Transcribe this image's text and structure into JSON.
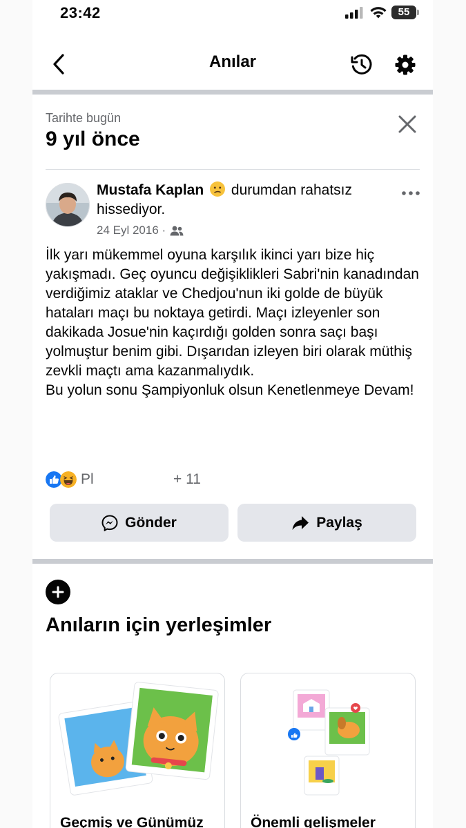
{
  "status_bar": {
    "time": "23:42",
    "battery": "55"
  },
  "header": {
    "title": "Anılar"
  },
  "memory": {
    "subtitle": "Tarihte bugün",
    "title": "9 yıl önce"
  },
  "post": {
    "author": "Mustafa Kaplan",
    "feeling": "durumdan rahatsız hissediyor.",
    "date": "24 Eyl 2016 ·",
    "body": "İlk yarı mükemmel oyuna karşılık ikinci yarı bize hiç yakışmadı. Geç oyuncu değişiklikleri Sabri'nin kanadından verdiğimiz ataklar ve Chedjou'nun iki golde de büyük hataları maçı bu noktaya getirdi. Maçı izleyenler son dakikada Josue'nin kaçırdığı golden sonra saçı başı yolmuştur benim gibi. Dışarıdan izleyen biri olarak müthiş zevkli maçtı ama kazanmalıydık.\nBu yolun sonu Şampiyonluk olsun Kenetlenmeye Devam!",
    "reactions_names": "Pl",
    "reactions_count": "+ 11"
  },
  "actions": {
    "send": "Gönder",
    "share": "Paylaş"
  },
  "section": {
    "title": "Anıların için yerleşimler",
    "tiles": [
      {
        "label": "Geçmiş ve Günümüz"
      },
      {
        "label": "Önemli gelişmeler"
      }
    ]
  },
  "colors": {
    "divider": "#c9ccd1",
    "button_bg": "#e4e6eb",
    "secondary_text": "#65676b",
    "like_blue": "#1877f2"
  }
}
